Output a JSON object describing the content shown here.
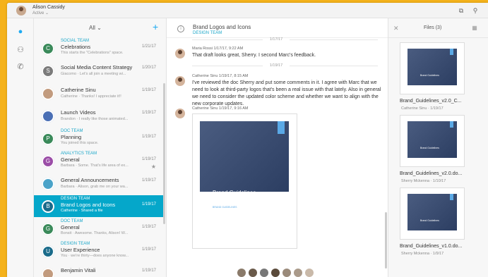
{
  "header": {
    "user_name": "Alison Cassidy",
    "user_status": "Active",
    "user_status_icon": "chevron-down-icon"
  },
  "rail": {
    "icons": [
      "chat-icon",
      "teams-icon",
      "phone-icon"
    ]
  },
  "list": {
    "filter_label": "All",
    "add_label": "+",
    "items": [
      {
        "team": "SOCIAL TEAM",
        "title": "Celebrations",
        "sub": "This starts the \"Celebrations\" space.",
        "date": "1/21/17",
        "initial": "C",
        "color": "#3a8a5a"
      },
      {
        "team": "",
        "title": "Social Media Content Strategy",
        "sub": "Giacomo · Let's all join a meeting wi...",
        "date": "1/20/17",
        "initial": "S",
        "color": "#7b7b7b"
      },
      {
        "team": "",
        "title": "Catherine Sinu",
        "sub": "Catherine · Thanks! I appreciate it!!",
        "date": "1/19/17",
        "initial": "",
        "color": "#c29b7e"
      },
      {
        "team": "",
        "title": "Launch Videos",
        "sub": "Brandon · I really like those animated...",
        "date": "1/19/17",
        "initial": "",
        "color": "#4a6fb5"
      },
      {
        "team": "DOC TEAM",
        "title": "Planning",
        "sub": "You joined this space.",
        "date": "1/19/17",
        "initial": "P",
        "color": "#3a8a5a"
      },
      {
        "team": "ANALYTICS TEAM",
        "title": "General",
        "sub": "Barbara · Some. That's life area of ex...",
        "date": "1/19/17",
        "initial": "G",
        "color": "#9b4da7"
      },
      {
        "team": "",
        "title": "General Announcements",
        "sub": "Barbara · Alison, grab me on your wa...",
        "date": "1/19/17",
        "initial": "",
        "color": "#4aa3c9"
      },
      {
        "team": "DESIGN TEAM",
        "title": "Brand Logos and Icons",
        "sub": "Catherine · Shared a file",
        "date": "1/19/17",
        "initial": "B",
        "color": "#1a6b8a",
        "selected": true
      },
      {
        "team": "DOC TEAM",
        "title": "General",
        "sub": "Bonsit · Awesome. Thanks, Alison! W...",
        "date": "1/19/17",
        "initial": "G",
        "color": "#3a8a5a"
      },
      {
        "team": "DESIGN TEAM",
        "title": "User Experience",
        "sub": "You · we're thirty—does anyone know...",
        "date": "1/19/17",
        "initial": "U",
        "color": "#1a6b8a"
      },
      {
        "team": "",
        "title": "Benjamin Vitali",
        "sub": "",
        "date": "1/19/17",
        "initial": "",
        "color": "#c29b7e"
      }
    ]
  },
  "conversation": {
    "title": "Brand Logos and Icons",
    "team": "DESIGN TEAM",
    "date_sep_1": "1/17/17",
    "msg1_meta": "Maria Rossi  1/17/17, 9:22 AM",
    "msg1_text": "That draft looks great, Sherry. I second Marc's feedback.",
    "date_sep_2": "1/19/17",
    "msg2_meta": "Catherine Sinu  1/19/17, 8:15 AM",
    "msg2_text": "I've reviewed the doc Sherry and put some comments in it. I agree with Marc that we need to look at third-party logos that's been a real issue with that lately. Also in general we need to consider the updated color scheme and whether we want to align with the new corporate updates.",
    "msg3_meta": "Catherine Sinu  1/19/17, 9:16 AM",
    "doc_title": "Brand Guidelines",
    "doc_foot": "BRAND GUIDELINES"
  },
  "files": {
    "title": "Files (3)",
    "items": [
      {
        "name": "Brand_Guidelines_v2.0_C...",
        "meta": "Catherine Sinu · 1/19/17",
        "cover": "Brand Guidelines"
      },
      {
        "name": "Brand_Guidelines_v2.0.do...",
        "meta": "Sherry Mckenna · 1/10/17",
        "cover": "Brand Guidelines"
      },
      {
        "name": "Brand_Guidelines_v1.0.do...",
        "meta": "Sherry Mckenna · 1/9/17",
        "cover": "Brand Guidelines"
      }
    ]
  }
}
